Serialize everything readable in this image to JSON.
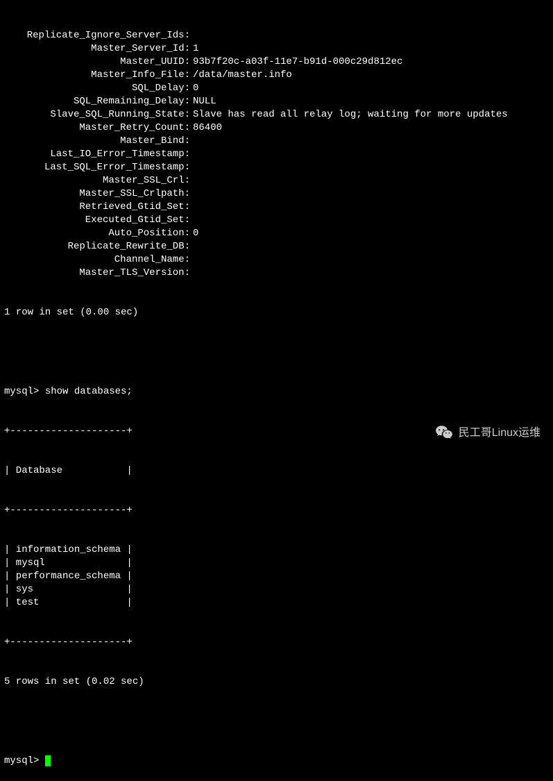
{
  "status_fields": [
    {
      "label": "Replicate_Ignore_Server_Ids:",
      "value": ""
    },
    {
      "label": "Master_Server_Id:",
      "value": "1"
    },
    {
      "label": "Master_UUID:",
      "value": "93b7f20c-a03f-11e7-b91d-000c29d812ec"
    },
    {
      "label": "Master_Info_File:",
      "value": "/data/master.info"
    },
    {
      "label": "SQL_Delay:",
      "value": "0"
    },
    {
      "label": "SQL_Remaining_Delay:",
      "value": "NULL"
    },
    {
      "label": "Slave_SQL_Running_State:",
      "value": "Slave has read all relay log; waiting for more updates"
    },
    {
      "label": "Master_Retry_Count:",
      "value": "86400"
    },
    {
      "label": "Master_Bind:",
      "value": ""
    },
    {
      "label": "Last_IO_Error_Timestamp:",
      "value": ""
    },
    {
      "label": "Last_SQL_Error_Timestamp:",
      "value": ""
    },
    {
      "label": "Master_SSL_Crl:",
      "value": ""
    },
    {
      "label": "Master_SSL_Crlpath:",
      "value": ""
    },
    {
      "label": "Retrieved_Gtid_Set:",
      "value": ""
    },
    {
      "label": "Executed_Gtid_Set:",
      "value": ""
    },
    {
      "label": "Auto_Position:",
      "value": "0"
    },
    {
      "label": "Replicate_Rewrite_DB:",
      "value": ""
    },
    {
      "label": "Channel_Name:",
      "value": ""
    },
    {
      "label": "Master_TLS_Version:",
      "value": ""
    }
  ],
  "status_footer": "1 row in set (0.00 sec)",
  "prompt": "mysql> ",
  "command": "show databases;",
  "table_border": "+--------------------+",
  "table_header": "| Database           |",
  "table_rows": [
    "| information_schema |",
    "| mysql              |",
    "| performance_schema |",
    "| sys                |",
    "| test               |"
  ],
  "table_footer": "5 rows in set (0.02 sec)",
  "watermark_text": "民工哥Linux运维"
}
